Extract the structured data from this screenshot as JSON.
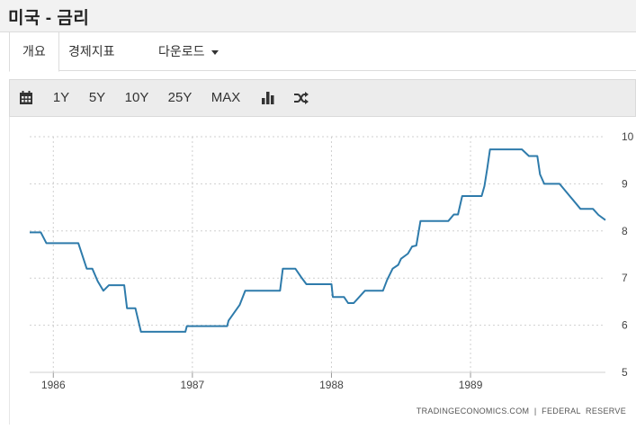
{
  "header": {
    "title": "미국 - 금리"
  },
  "tabs": [
    {
      "label": "개요",
      "active": true
    },
    {
      "label": "경제지표",
      "active": false
    },
    {
      "label": "다운로드",
      "active": false,
      "dropdown": true
    }
  ],
  "toolbar": {
    "calendar_icon": "calendar-icon",
    "ranges": [
      "1Y",
      "5Y",
      "10Y",
      "25Y",
      "MAX"
    ],
    "chart_type_icon": "bar-chart-icon",
    "compare_icon": "shuffle-icon"
  },
  "source": "TRADINGECONOMICS.COM  |  FEDERAL  RESERVE",
  "colors": {
    "line": "#2e7bab",
    "grid": "#cfcfcf",
    "text": "#444444"
  },
  "chart_data": {
    "type": "line",
    "title": "",
    "xlabel": "",
    "ylabel": "",
    "x_ticks": [
      "1986",
      "1987",
      "1988",
      "1989"
    ],
    "y_ticks": [
      5,
      6,
      7,
      8,
      9,
      10
    ],
    "ylim": [
      5,
      10
    ],
    "xlim": [
      1985.83,
      1989.97
    ],
    "grid": "dotted horizontal and vertical",
    "y_axis_position": "right",
    "series": [
      {
        "x": [
          1985.83,
          1985.91,
          1985.95,
          1986.0,
          1986.09,
          1986.18,
          1986.24,
          1986.28,
          1986.32,
          1986.36,
          1986.4,
          1986.51,
          1986.53,
          1986.59,
          1986.63,
          1986.95,
          1986.96,
          1987.05,
          1987.1,
          1987.25,
          1987.26,
          1987.34,
          1987.38,
          1987.42,
          1987.48,
          1987.63,
          1987.65,
          1987.74,
          1987.78,
          1987.82,
          1988.0,
          1988.01,
          1988.09,
          1988.12,
          1988.16,
          1988.24,
          1988.34,
          1988.37,
          1988.4,
          1988.44,
          1988.48,
          1988.5,
          1988.55,
          1988.58,
          1988.61,
          1988.64,
          1988.84,
          1988.88,
          1988.91,
          1988.94,
          1989.08,
          1989.1,
          1989.12,
          1989.14,
          1989.37,
          1989.42,
          1989.45,
          1989.48,
          1989.5,
          1989.53,
          1989.58,
          1989.61,
          1989.64,
          1989.79,
          1989.83,
          1989.88,
          1989.92,
          1989.97
        ],
        "y": [
          7.97,
          7.97,
          7.74,
          7.74,
          7.74,
          7.74,
          7.2,
          7.2,
          6.93,
          6.73,
          6.85,
          6.85,
          6.36,
          6.36,
          5.86,
          5.86,
          5.98,
          5.98,
          5.98,
          5.98,
          6.1,
          6.43,
          6.73,
          6.73,
          6.73,
          6.73,
          7.2,
          7.2,
          7.03,
          6.87,
          6.87,
          6.6,
          6.6,
          6.47,
          6.47,
          6.73,
          6.73,
          6.73,
          6.96,
          7.2,
          7.28,
          7.41,
          7.52,
          7.67,
          7.69,
          8.21,
          8.21,
          8.35,
          8.35,
          8.74,
          8.74,
          8.95,
          9.32,
          9.73,
          9.73,
          9.59,
          9.59,
          9.59,
          9.2,
          9.0,
          9.0,
          9.0,
          9.0,
          8.47,
          8.47,
          8.47,
          8.34,
          8.23
        ]
      }
    ]
  }
}
